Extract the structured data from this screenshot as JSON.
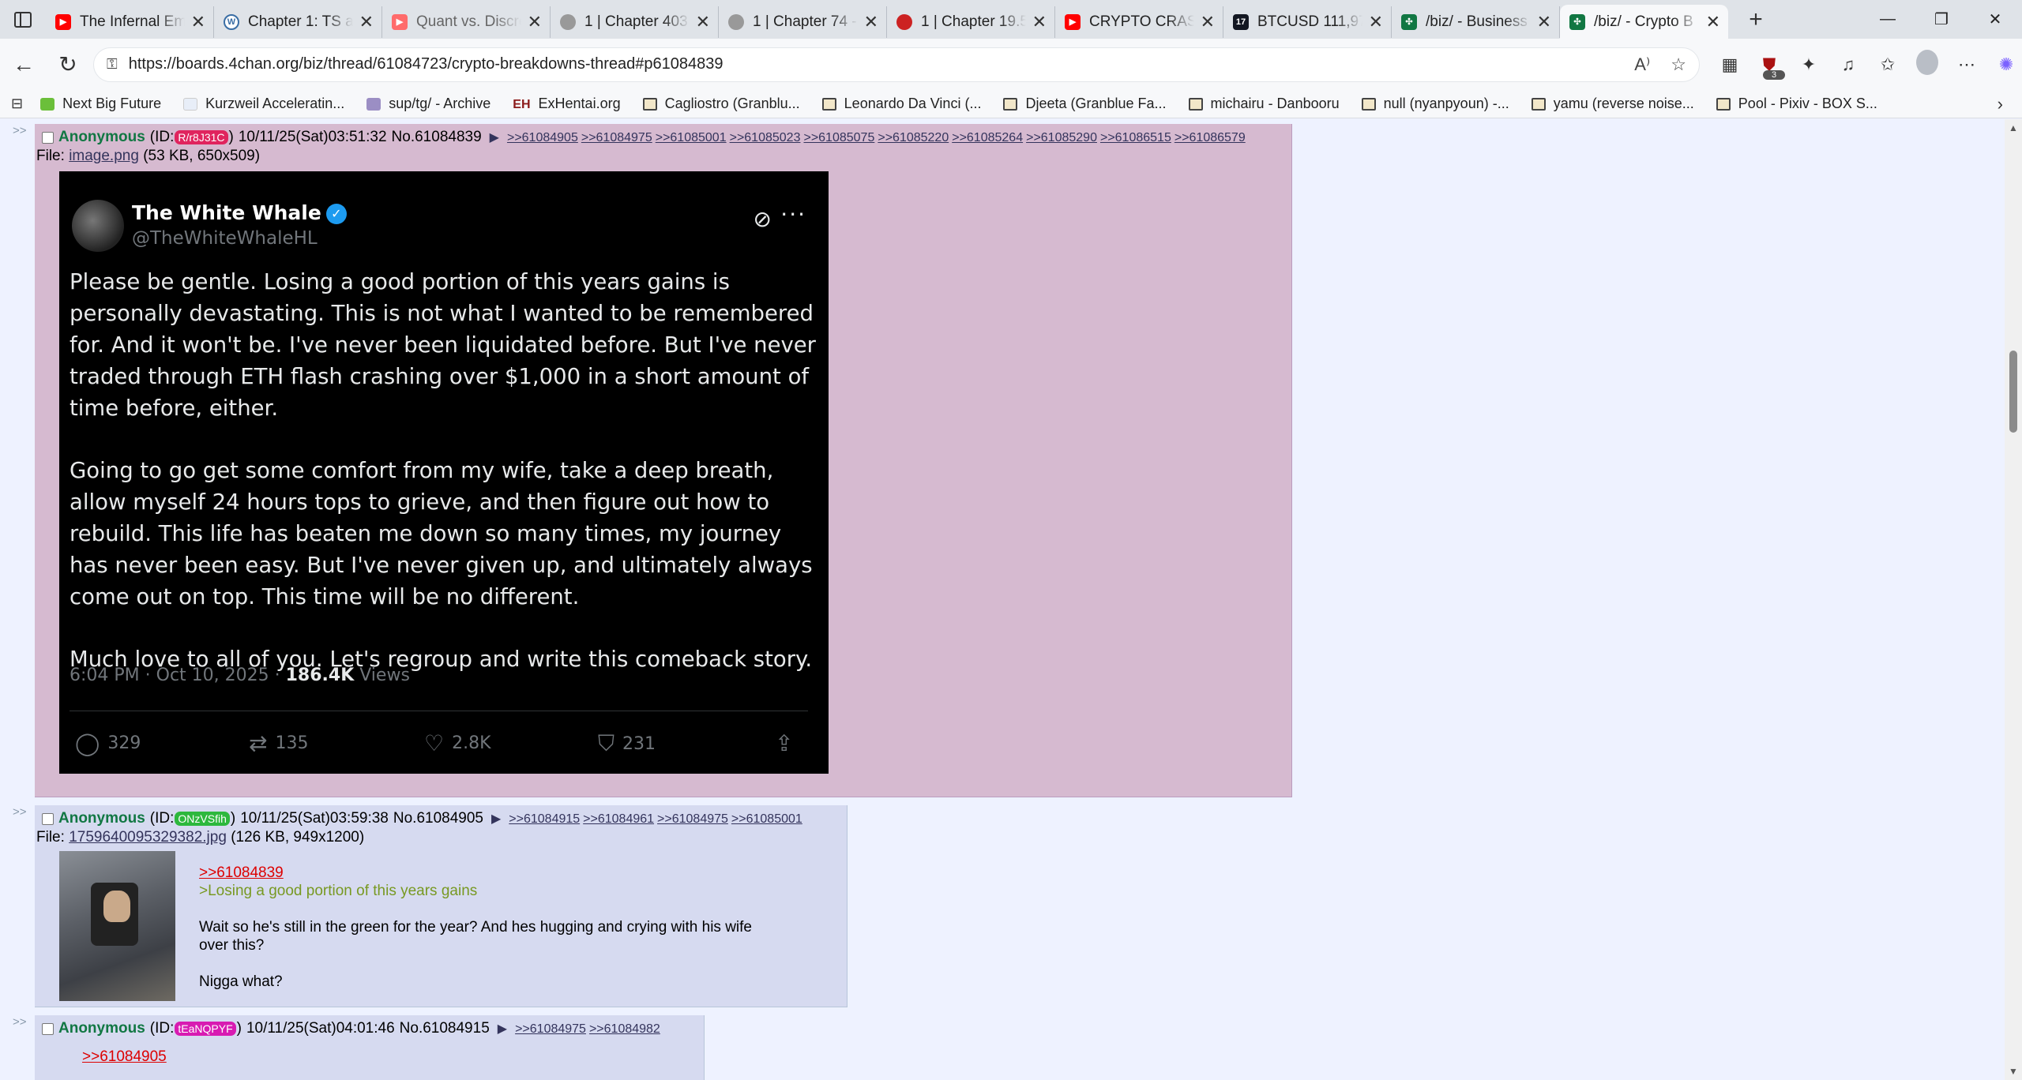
{
  "browser": {
    "tabs": [
      {
        "title": "The Infernal Em",
        "icon": "youtube-icon",
        "color": "#ff0000"
      },
      {
        "title": "Chapter 1: TS ar",
        "icon": "wordpress-icon",
        "color": "#3a6ea5"
      },
      {
        "title": "Quant vs. Discre",
        "icon": "youtube-icon",
        "color": "#ff0000"
      },
      {
        "title": "1 | Chapter 403",
        "icon": "manga-icon",
        "color": "#888888"
      },
      {
        "title": "1 | Chapter 74 -",
        "icon": "manga-icon",
        "color": "#888888"
      },
      {
        "title": "1 | Chapter 19.5",
        "icon": "manga-red-icon",
        "color": "#cc2222"
      },
      {
        "title": "CRYPTO CRASH",
        "icon": "youtube-icon",
        "color": "#ff0000"
      },
      {
        "title": "BTCUSD 111,97",
        "icon": "tradingview-icon",
        "color": "#131722"
      },
      {
        "title": "/biz/ - Business",
        "icon": "4chan-icon",
        "color": "#117743"
      },
      {
        "title": "/biz/ - Crypto B",
        "icon": "4chan-icon",
        "color": "#117743",
        "active": true
      }
    ],
    "url": "https://boards.4chan.org/biz/thread/61084723/crypto-breakdowns-thread#p61084839",
    "extension_badge": "3",
    "bookmarks": [
      "Next Big Future",
      "Kurzweil Acceleratin...",
      "sup/tg/ - Archive",
      "ExHentai.org",
      "Cagliostro (Granblu...",
      "Leonardo Da Vinci (...",
      "Djeeta (Granblue Fa...",
      "michairu - Danbooru",
      "null (nyanpyoun) -...",
      "yamu (reverse noise...",
      "Pool - Pixiv - BOX S..."
    ]
  },
  "posts": [
    {
      "name": "Anonymous",
      "id_prefix": "(ID:",
      "id": "R/r8J31C",
      "id_suffix": ")",
      "id_color": "#e0245e",
      "datetime": "10/11/25(Sat)03:51:32",
      "no": "No.61084839",
      "backlinks": [
        ">>61084905",
        ">>61084975",
        ">>61085001",
        ">>61085023",
        ">>61085075",
        ">>61085220",
        ">>61085264",
        ">>61085290",
        ">>61086515",
        ">>61086579"
      ],
      "file_label": "File:",
      "file_name": "image.png",
      "file_meta": "(53 KB, 650x509)",
      "tweet": {
        "name": "The White Whale",
        "handle": "@TheWhiteWhaleHL",
        "paragraphs": [
          "Please be gentle. Losing a good portion of this years gains is personally devastating. This is not what I wanted to be remembered for. And it won't be. I've never been liquidated before. But I've never traded through ETH flash crashing over $1,000 in a short amount of time before, either.",
          "Going to go get some comfort from my wife, take a deep breath, allow myself 24 hours tops to grieve, and then figure out how to rebuild. This life has beaten me down so many times, my journey has never been easy. But I've never given up, and ultimately always come out on top. This time will be no different.",
          "Much love to all of you. Let's regroup and write this comeback story."
        ],
        "time": "6:04 PM · Oct 10, 2025 · ",
        "views_count": "186.4K",
        "views_label": " Views",
        "replies": "329",
        "reposts": "135",
        "likes": "2.8K",
        "bookmarks": "231"
      }
    },
    {
      "name": "Anonymous",
      "id_prefix": "(ID:",
      "id": "ONzVSfih",
      "id_suffix": ")",
      "id_color": "#2db83d",
      "datetime": "10/11/25(Sat)03:59:38",
      "no": "No.61084905",
      "backlinks": [
        ">>61084915",
        ">>61084961",
        ">>61084975",
        ">>61085001"
      ],
      "file_label": "File:",
      "file_name": "1759640095329382.jpg",
      "file_meta": "(126 KB, 949x1200)",
      "quote_link": ">>61084839",
      "greentext": ">Losing a good portion of this years gains",
      "line1": "Wait so he's still in the green for the year? And hes hugging and crying with his wife",
      "line2": "over this?",
      "line3": "Nigga what?"
    },
    {
      "name": "Anonymous",
      "id_prefix": "(ID:",
      "id": "tEaNQPYF",
      "id_suffix": ")",
      "id_color": "#d81bb2",
      "datetime": "10/11/25(Sat)04:01:46",
      "no": "No.61084915",
      "backlinks": [
        ">>61084975",
        ">>61084982"
      ],
      "quote_link": ">>61084905"
    }
  ]
}
